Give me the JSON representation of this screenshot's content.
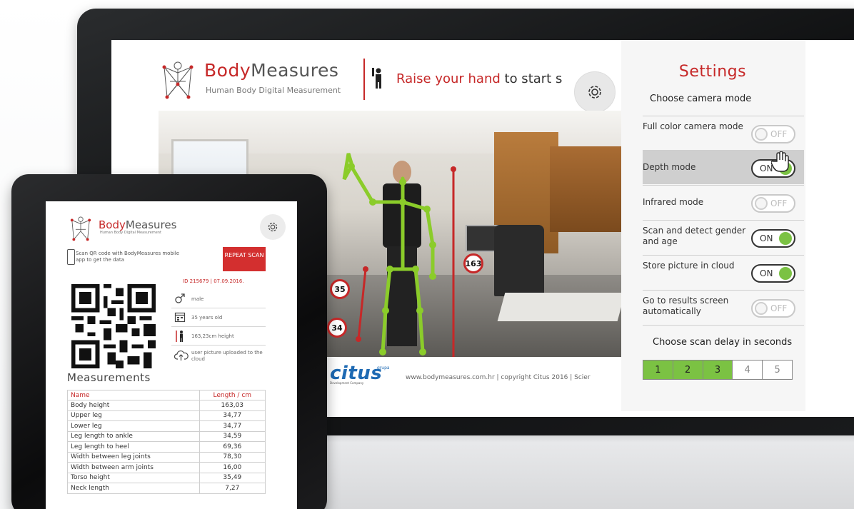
{
  "monitor": {
    "brand_part1": "Body",
    "brand_part2": "Measures",
    "brand_subtitle": "Human Body Digital Measurement",
    "raise_highlight": "Raise your hand",
    "raise_rest": " to start s",
    "badges": [
      "163",
      "35",
      "34"
    ],
    "footer_logo": "citus",
    "footer_logo_sup": "grupa",
    "footer_logo_sub": "Development Company",
    "footer_text": "www.bodymeasures.com.hr  |  copyright Citus 2016  |  Scier"
  },
  "settings": {
    "title": "Settings",
    "camera_mode_label": "Choose camera mode",
    "rows": [
      {
        "label": "Full color camera mode",
        "state": "OFF"
      },
      {
        "label": "Depth mode",
        "state": "ON"
      },
      {
        "label": "Infrared mode",
        "state": "OFF"
      },
      {
        "label": "Scan and detect gender and age",
        "state": "ON"
      },
      {
        "label": "Store picture in cloud",
        "state": "ON"
      },
      {
        "label": "Go to results screen automatically",
        "state": "OFF"
      }
    ],
    "delay_label": "Choose scan delay in seconds",
    "delay_options": [
      "1",
      "2",
      "3",
      "4",
      "5"
    ],
    "delay_selected": 3
  },
  "tablet": {
    "brand_part1": "Body",
    "brand_part2": "Measures",
    "brand_subtitle": "Human Body Digital Measurement",
    "scan_note": "Scan QR code with BodyMeasures mobile app to get the data",
    "repeat_label": "REPEAT SCAN",
    "id_text": "ID 215679  |  07.09.2016.",
    "info": [
      {
        "icon": "gender-icon",
        "text": "male"
      },
      {
        "icon": "calendar-icon",
        "text": "35 years old"
      },
      {
        "icon": "height-icon",
        "text": "163,23cm height"
      },
      {
        "icon": "cloud-upload-icon",
        "text": "user picture uploaded to the cloud"
      }
    ],
    "measurements_title": "Measurements",
    "table_headers": [
      "Name",
      "Length / cm"
    ],
    "table_rows": [
      [
        "Body height",
        "163,03"
      ],
      [
        "Upper leg",
        "34,77"
      ],
      [
        "Lower leg",
        "34,77"
      ],
      [
        "Leg length to ankle",
        "34,59"
      ],
      [
        "Leg length to heel",
        "69,36"
      ],
      [
        "Width between leg joints",
        "78,30"
      ],
      [
        "Width between arm joints",
        "16,00"
      ],
      [
        "Torso height",
        "35,49"
      ],
      [
        "Neck length",
        "7,27"
      ]
    ]
  },
  "colors": {
    "brand_red": "#c62828",
    "toggle_green": "#7bc243",
    "citus_blue": "#1e6ab3"
  }
}
